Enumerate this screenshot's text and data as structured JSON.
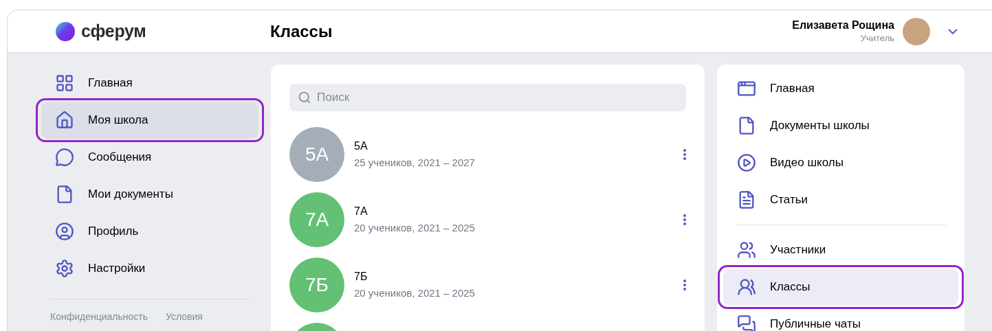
{
  "header": {
    "logo": "сферум",
    "title": "Классы",
    "user": {
      "name": "Елизавета Рощина",
      "role": "Учитель"
    }
  },
  "sidebar": {
    "items": [
      {
        "label": "Главная",
        "selected": false,
        "highlighted": false
      },
      {
        "label": "Моя школа",
        "selected": true,
        "highlighted": true
      },
      {
        "label": "Сообщения",
        "selected": false,
        "highlighted": false
      },
      {
        "label": "Мои документы",
        "selected": false,
        "highlighted": false
      },
      {
        "label": "Профиль",
        "selected": false,
        "highlighted": false
      },
      {
        "label": "Настройки",
        "selected": false,
        "highlighted": false
      }
    ],
    "footer_links": [
      "Конфиденциальность",
      "Условия"
    ]
  },
  "classes": {
    "search": {
      "placeholder": "Поиск"
    },
    "items": [
      {
        "avatar": "5А",
        "name": "5А",
        "details": "25 учеников, 2021 – 2027",
        "color": "#a5adb8"
      },
      {
        "avatar": "7А",
        "name": "7А",
        "details": "20 учеников, 2021 – 2025",
        "color": "#62c174"
      },
      {
        "avatar": "7Б",
        "name": "7Б",
        "details": "20 учеников, 2021 – 2025",
        "color": "#62c174"
      },
      {
        "color": "#62c174"
      }
    ]
  },
  "school_menu": {
    "sections": [
      {
        "items": [
          {
            "label": "Главная",
            "selected": false,
            "highlighted": false
          },
          {
            "label": "Документы школы",
            "selected": false,
            "highlighted": false
          },
          {
            "label": "Видео школы",
            "selected": false,
            "highlighted": false
          },
          {
            "label": "Статьи",
            "selected": false,
            "highlighted": false
          }
        ]
      },
      {
        "items": [
          {
            "label": "Участники",
            "selected": false,
            "highlighted": false
          },
          {
            "label": "Классы",
            "selected": true,
            "highlighted": true
          },
          {
            "label": "Публичные чаты",
            "selected": false,
            "highlighted": false
          }
        ]
      }
    ]
  }
}
